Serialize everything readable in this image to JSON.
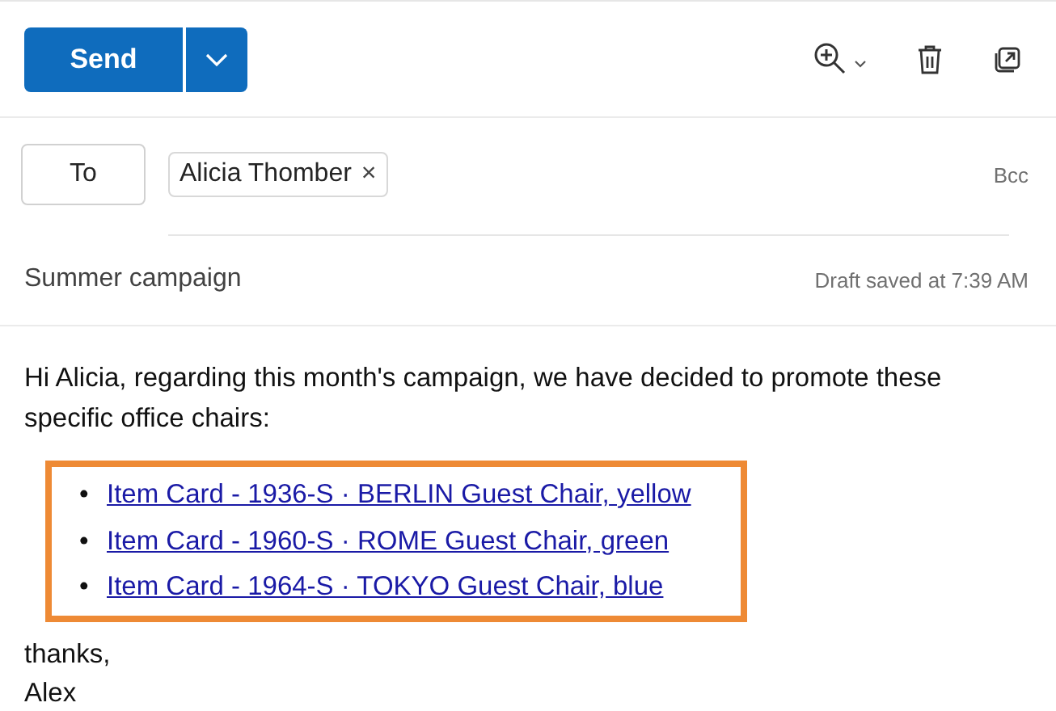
{
  "toolbar": {
    "send_label": "Send"
  },
  "recipients": {
    "to_label": "To",
    "chips": [
      {
        "name": "Alicia Thomber",
        "remove": "×"
      }
    ],
    "bcc_label": "Bcc"
  },
  "subject": "Summer campaign",
  "draft_status": "Draft saved at 7:39 AM",
  "body": {
    "intro": "Hi Alicia, regarding this month's campaign, we have decided to promote these specific office chairs:",
    "links": [
      {
        "bullet": "•",
        "text": "Item Card - 1936-S · BERLIN Guest Chair, yellow"
      },
      {
        "bullet": "•",
        "text": "Item Card - 1960-S · ROME Guest Chair, green"
      },
      {
        "bullet": "•",
        "text": "Item Card - 1964-S · TOKYO Guest Chair, blue"
      }
    ],
    "closing": "thanks,",
    "signature": "Alex"
  }
}
